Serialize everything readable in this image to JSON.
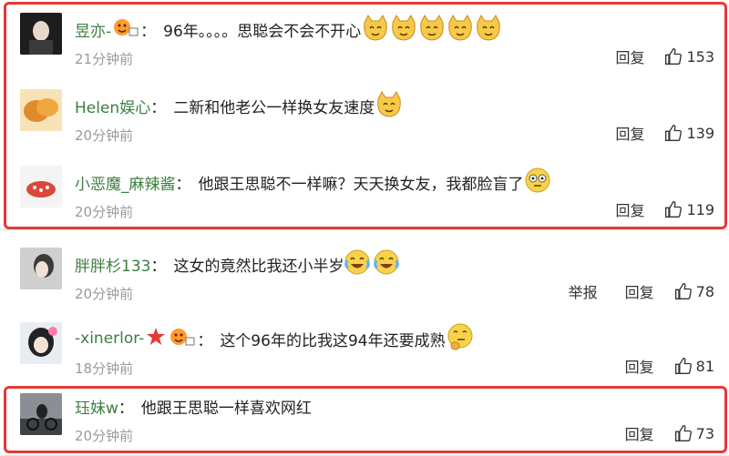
{
  "comments": [
    {
      "user": "昱亦-",
      "text": "96年。。。。思聪会不会不开心",
      "time": "21分钟前",
      "reply": "回复",
      "report": "",
      "likes": "153"
    },
    {
      "user": "Helen娱心",
      "text": "二新和他老公一样换女友速度",
      "time": "20分钟前",
      "reply": "回复",
      "report": "",
      "likes": "139"
    },
    {
      "user": "小恶魔_麻辣酱",
      "text": "他跟王思聪不一样嘛？天天换女友，我都脸盲了",
      "time": "20分钟前",
      "reply": "回复",
      "report": "",
      "likes": "119"
    },
    {
      "user": "胖胖杉133",
      "text": "这女的竟然比我还小半岁",
      "time": "20分钟前",
      "reply": "回复",
      "report": "举报",
      "likes": "78"
    },
    {
      "user": "-xinerlor-",
      "text": "这个96年的比我这94年还要成熟",
      "time": "18分钟前",
      "reply": "回复",
      "report": "",
      "likes": "81"
    },
    {
      "user": "珏妹w",
      "text": "他跟王思聪一样喜欢网红",
      "time": "20分钟前",
      "reply": "回复",
      "report": "",
      "likes": "73"
    }
  ],
  "colors": {
    "username": "#3b7f3f",
    "highlight": "#e53935",
    "meta": "#9a9a9a"
  },
  "icons": [
    "thumbs-up-icon",
    "cat-emoji-icon",
    "laugh-cry-emoji-icon",
    "thinking-emoji-icon",
    "eyes-emoji-icon",
    "fan-badge-icon",
    "star-badge-icon"
  ]
}
